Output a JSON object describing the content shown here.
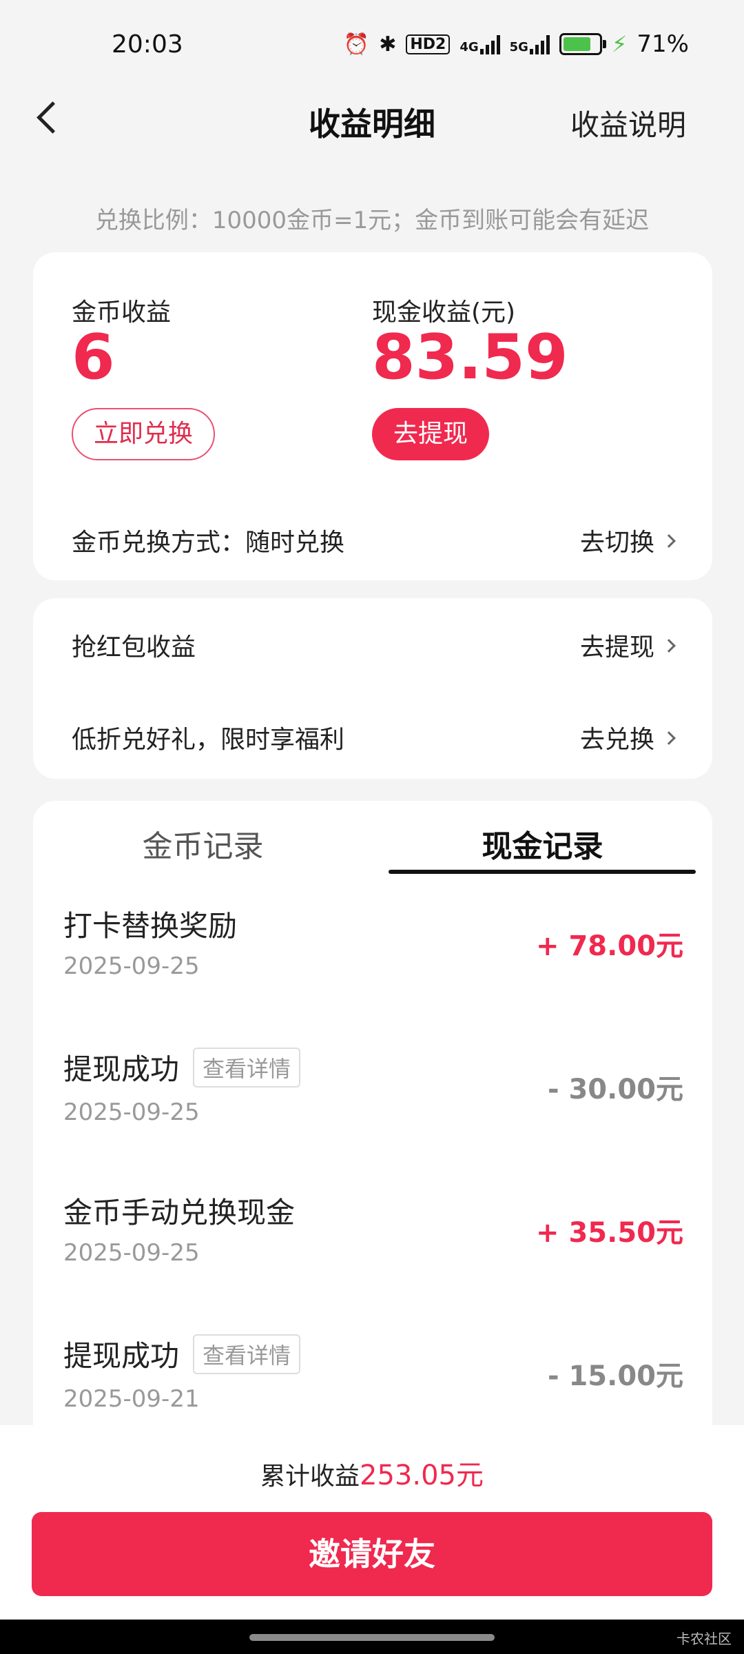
{
  "status": {
    "time": "20:03",
    "alarm": "⏰",
    "bluetooth": "✱",
    "hd": "HD2",
    "net4g": "4G",
    "net5g": "5G",
    "battery": "71%",
    "bolt": "⚡"
  },
  "header": {
    "title": "收益明细",
    "help_link": "收益说明"
  },
  "ratio_note": "兑换比例：10000金币=1元；金币到账可能会有延迟",
  "earnings": {
    "coin_label": "金币收益",
    "coin_value": "6",
    "coin_button": "立即兑换",
    "cash_label": "现金收益(元)",
    "cash_value": "83.59",
    "cash_button": "去提现",
    "exchange_mode_label": "金币兑换方式：随时兑换",
    "exchange_mode_action": "去切换"
  },
  "promos": [
    {
      "label": "抢红包收益",
      "action": "去提现"
    },
    {
      "label": "低折兑好礼，限时享福利",
      "action": "去兑换"
    }
  ],
  "tabs": [
    {
      "label": "金币记录",
      "active": false
    },
    {
      "label": "现金记录",
      "active": true
    }
  ],
  "records": [
    {
      "title": "打卡替换奖励",
      "date": "2025-09-25",
      "amount": "+ 78.00元",
      "sign": "positive"
    },
    {
      "title": "提现成功",
      "tag": "查看详情",
      "date": "2025-09-25",
      "amount": "- 30.00元",
      "sign": "negative"
    },
    {
      "title": "金币手动兑换现金",
      "date": "2025-09-25",
      "amount": "+ 35.50元",
      "sign": "positive"
    },
    {
      "title": "提现成功",
      "tag": "查看详情",
      "date": "2025-09-21",
      "amount": "- 15.00元",
      "sign": "negative"
    }
  ],
  "footer": {
    "total_label": "累计收益",
    "total_value": "253.05元",
    "invite_button": "邀请好友"
  },
  "watermark": "卡农社区",
  "colors": {
    "accent": "#f0294f",
    "positive": "#f0294f",
    "negative": "#888888",
    "battery": "#4cc24a"
  }
}
